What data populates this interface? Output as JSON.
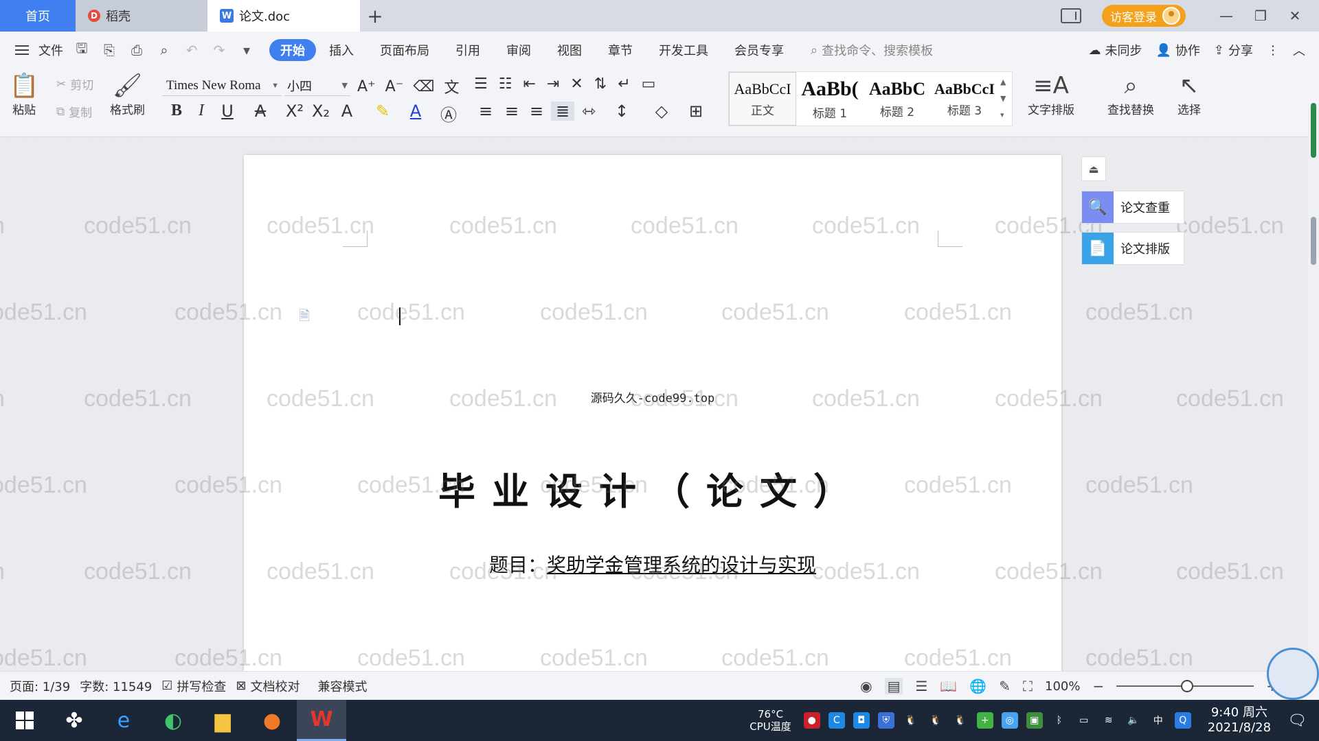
{
  "tabs": {
    "home": "首页",
    "daoke": "稻壳",
    "doc": "论文.doc",
    "add": "+"
  },
  "header": {
    "login": "访客登录",
    "minimize": "—",
    "restore": "❐",
    "close": "✕"
  },
  "menu": {
    "file": "文件",
    "tabs": [
      "开始",
      "插入",
      "页面布局",
      "引用",
      "审阅",
      "视图",
      "章节",
      "开发工具",
      "会员专享"
    ],
    "search_placeholder": "查找命令、搜索模板",
    "unsynced": "未同步",
    "collab": "协作",
    "share": "分享"
  },
  "ribbon": {
    "paste": "粘贴",
    "cut": "剪切",
    "copy": "复制",
    "format_painter": "格式刷",
    "font_name": "Times New Roma",
    "font_size": "小四",
    "styles": [
      {
        "sample": "AaBbCcI",
        "label": "正文"
      },
      {
        "sample": "AaBb(",
        "label": "标题 1"
      },
      {
        "sample": "AaBbC",
        "label": "标题 2"
      },
      {
        "sample": "AaBbCcI",
        "label": "标题 3"
      }
    ],
    "text_layout": "文字排版",
    "find_replace": "查找替换",
    "select": "选择"
  },
  "document": {
    "top_line": "源码久久-code99.top",
    "title": "毕业设计（论文）",
    "subject_label": "题目：",
    "subject_value": "奖助学金管理系统的设计与实现",
    "watermark": "code51.cn"
  },
  "side_panel": {
    "check": "论文查重",
    "layout": "论文排版"
  },
  "status": {
    "page": "页面: 1/39",
    "words": "字数: 11549",
    "spellcheck": "拼写检查",
    "doc_proof": "文档校对",
    "compat": "兼容模式",
    "zoom": "100%"
  },
  "taskbar": {
    "temp": "76°C",
    "cpu_label": "CPU温度",
    "ime": "中",
    "time": "9:40 周六",
    "date": "2021/8/28"
  }
}
